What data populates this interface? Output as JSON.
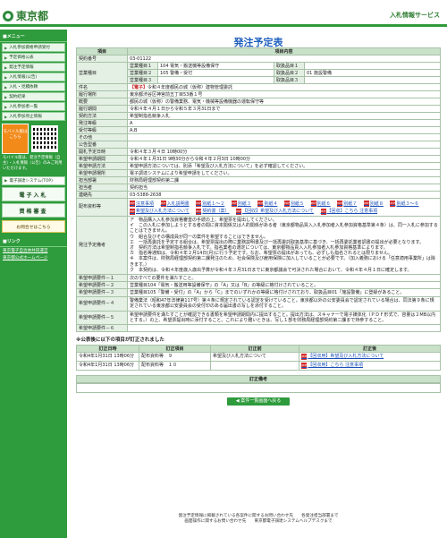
{
  "header": {
    "logo": "東京都",
    "right_link": "入札情報サービス"
  },
  "sidebar": {
    "menu_head": "■メニュー",
    "items": [
      "入札参加資格申請受付",
      "予定価格公表",
      "発注予定情報",
      "入札情報(公告)",
      "入札・見積依頼",
      "契約結果",
      "入札参加者一覧",
      "入札参加停止情報"
    ],
    "mobile_badge": "モバイル版はこちら",
    "mobile_note": "モバイル版は、発注予定情報（自主）・入札情報（公告）のみご利用いただけます。",
    "jsc_link": "電子調達システム(TOP)",
    "btn_bid": "電子入札",
    "btn_qual": "資格審査",
    "contact": "お問合せはこちら",
    "links_head": "■リンク",
    "links": [
      "東京電子自治体共同運営",
      "東京都公式ホームページ"
    ]
  },
  "main": {
    "title": "発注予定表",
    "col_item": "項目",
    "col_content": "項目内容",
    "rows": {
      "contract_no": {
        "label": "契約番号",
        "value": "03-01122"
      },
      "ind1_label": "営業種目１",
      "ind1": "104 電気・搬送機等設備保守",
      "ind2_label": "営業種目２",
      "ind2": "105 警備・受付",
      "ind3_label": "営業種目３",
      "ind3": "",
      "biz_label": "営業種目",
      "tk1_label": "取扱品目１",
      "tk1": "",
      "tk2_label": "取扱品目２",
      "tk2": "01 施設警備",
      "tk3_label": "取扱品目３",
      "tk3": "",
      "subject": {
        "label": "件名",
        "tag": "【電子】",
        "value": "令和４年度都民の城（仮称）建物管理委託"
      },
      "place": {
        "label": "履行場所",
        "value": "東京都渋谷区神宮前五丁目53番１号"
      },
      "summary": {
        "label": "概要",
        "value": "都民の城（仮称）の警備業務、電気・機械等設備機器の運転保守等"
      },
      "period": {
        "label": "履行期間",
        "value": "令和４年４月１日から令和５年３月31日まで"
      },
      "method": {
        "label": "契約方法",
        "value": "希望制指名競争入札"
      },
      "grade": {
        "label": "発注等級",
        "value": "A"
      },
      "rank": {
        "label": "受付等級",
        "value": "A,B"
      },
      "other": {
        "label": "その他",
        "value": ""
      },
      "notice_date": {
        "label": "公告型番",
        "value": ""
      },
      "open_date": {
        "label": "開札予定日時",
        "value": "令和４年３月４日 10時00分"
      },
      "apply_period": {
        "label": "希望申請期間",
        "value": "令和４年１月31日 9時30分から令和４年２月3日 10時00分"
      },
      "apply_method": {
        "label": "希望申請方法",
        "value": "希望申請方法については、別添「希望及び入札方法について」を必ず確認してください。"
      },
      "apply_place": {
        "label": "希望申請場所",
        "value": "電子調達システムにより希望申請をしてください。"
      },
      "dept": {
        "label": "担当部署",
        "value": "財務局経理部契約第二課"
      },
      "staff": {
        "label": "担当者",
        "value": "契約担当"
      },
      "tel": {
        "label": "連絡先",
        "value": "03-5388-2638"
      },
      "docs": {
        "label": "配布資料等",
        "items": [
          "注意事項",
          "入札説明書",
          "別紙１～２",
          "別紙３",
          "別紙４",
          "別紙５",
          "別紙６",
          "別紙７",
          "別紙８",
          "別紙３～６",
          "希望及び入札方法について",
          "契約書（案）",
          "【回収】希望及び入札方法について",
          "【回収】こちら 注意事項"
        ]
      },
      "remarks": {
        "label": "発注予定備考",
        "lines": [
          "ア　物品購入入札参加資格審査の手続の上、希望票を提出してください。",
          "イ　この入札に参加しようとする者の間に資本関係又は人的関係がある者（東京都物品買入入札参加者入札参加資格基準第４条）は、同一入札に参加することはできません。",
          "ウ　組合及びその構成員が同一の案件を希望することはできません。",
          "エ　一括再委託を予定する組合は、希望票提出の際に業務説明書及び一括再委託取扱基準に基づき、一括再委託業者調書の提出が必要となります。",
          "オ　契約方法は希望制指名競争入札です。指名業者の選定については、東京都物品買入入札参加者入札参加資格基準によります。",
          "カ　指名等通知は、令和４年２月14日(月)に行う予定です。なお、希望票の提出があっても、必ずしも指名されるとは限りません。",
          "キ　本案件は、財務局経理部契約第二課発注のため、社会保険及び雇用保険に加入していることが必要です。（加入義務における「任意適用事業所」は除きます。）",
          "ク　本契約は、令和４年度歳入歳出予算が令和４年３月31日までに東京都議会で可決された場合において、令和４年４月１日に確定します。"
        ]
      },
      "req1": {
        "label": "希望申請要件－１",
        "value": "次のすべての要件を満たすこと。"
      },
      "req2": {
        "label": "希望申請要件－２",
        "value": "営業種目104「電気・搬送用等設備保守」の「A」又は「B」の等級に格付けされていること。"
      },
      "req3": {
        "label": "希望申請要件－３",
        "value": "営業種目105「警備・受付」の「A」から「C」までのいずれかの等級に格付けされており、取扱品目01「施設警備」に登録があること。"
      },
      "req4": {
        "label": "希望申請要件－４",
        "value": "警備業法（昭和47年法律第117号）第４条に規定されている認定を受けていること。東京都以外の公安委員会で認定されている場合は、同法第９条に規定されている東京都公安委員会の受付印のある届出書の写しを添付すること。"
      },
      "req5": {
        "label": "希望申請要件－５",
        "value": "希望申請要件を満たすことが確認できる書類を希望申請期間内に提出すること。提出方法は、スキャナーで電子媒体化（ＰＤＦ形式で、容量は２MB以内とする。）の上、希望票提出時に添付すること。これにより難いときは、写し１部を財務局経理部契約第二課まで持参すること。"
      },
      "req6": {
        "label": "希望申請要件－６",
        "value": ""
      }
    },
    "updates": {
      "title": "※公表後に以下の項目が訂正されました",
      "cols": [
        "訂正日時",
        "訂正項目",
        "訂正前",
        "訂正後"
      ],
      "rows": [
        {
          "date": "令和4年1月31日 13時06分",
          "item": "配布資料等　９",
          "before": "希望及び入札方法について",
          "after": "【回収用】希望及び入札方法について"
        },
        {
          "date": "令和4年1月31日 13時06分",
          "item": "配布資料等　１０",
          "before": "",
          "after": "【回収用】こちら 注意事項"
        }
      ]
    },
    "remarks_head": "訂正備考",
    "back_button": "案件一覧画面へ戻る"
  },
  "footer": {
    "line1": "発注予定情報に掲載されている各案件に関するお問い合わせ先　　各発注担当部署まで",
    "line2": "画面操作に関するお問い合わせ先　　東京都電子調達システムヘルプデスクまで"
  }
}
